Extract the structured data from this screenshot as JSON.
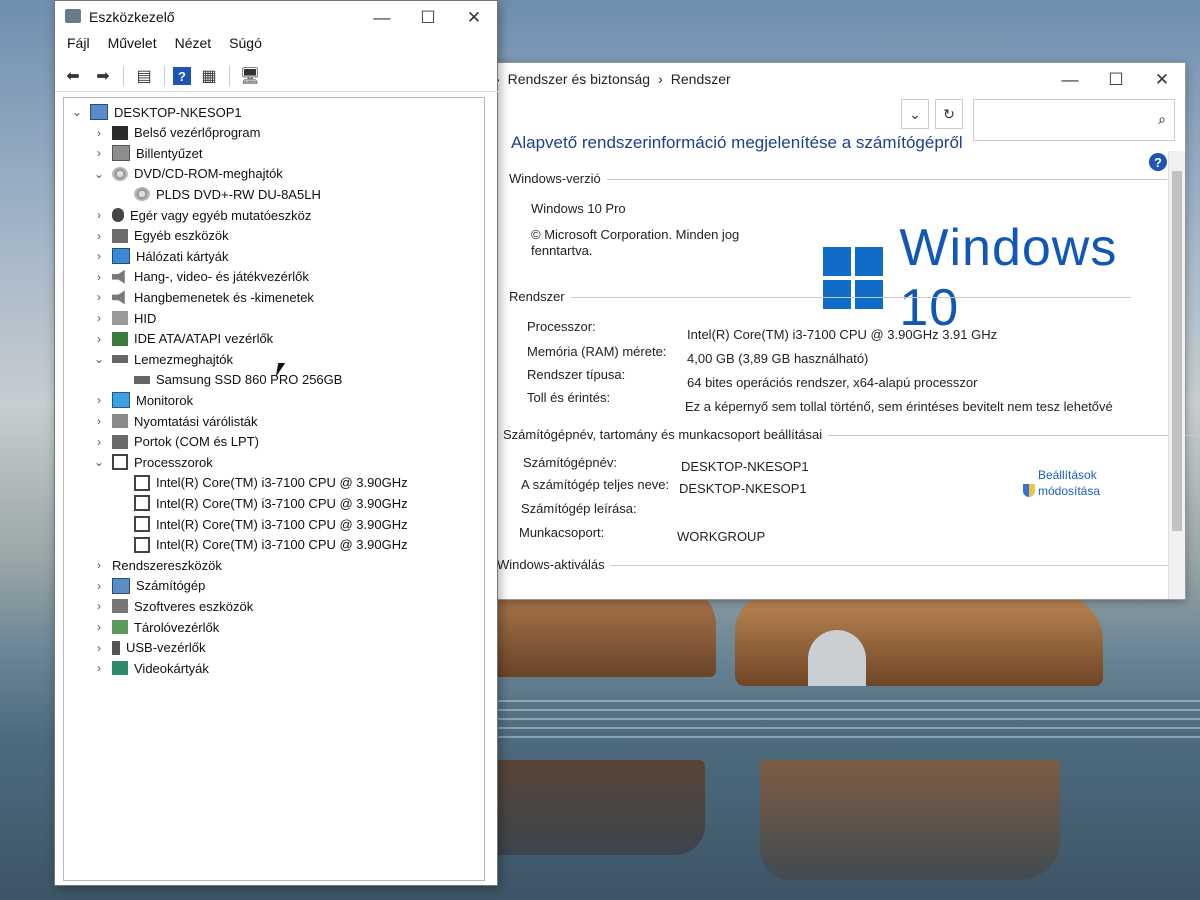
{
  "device_manager": {
    "title": "Eszközkezelő",
    "menu": [
      "Fájl",
      "Művelet",
      "Nézet",
      "Súgó"
    ],
    "tree": [
      {
        "label": "DESKTOP-NKESOP1",
        "level": 0,
        "expanded": true,
        "icon": "computer-icon"
      },
      {
        "label": "Belső vezérlőprogram",
        "level": 1,
        "expanded": false,
        "icon": "chip-icon"
      },
      {
        "label": "Billentyűzet",
        "level": 1,
        "expanded": false,
        "icon": "keyboard-icon"
      },
      {
        "label": "DVD/CD-ROM-meghajtók",
        "level": 1,
        "expanded": true,
        "icon": "disc-icon"
      },
      {
        "label": "PLDS DVD+-RW DU-8A5LH",
        "level": 2,
        "icon": "disc-icon"
      },
      {
        "label": "Egér vagy egyéb mutatóeszköz",
        "level": 1,
        "expanded": false,
        "icon": "mouse-icon"
      },
      {
        "label": "Egyéb eszközök",
        "level": 1,
        "expanded": false,
        "icon": "other-device-icon"
      },
      {
        "label": "Hálózati kártyák",
        "level": 1,
        "expanded": false,
        "icon": "network-icon"
      },
      {
        "label": "Hang-, video- és játékvezérlők",
        "level": 1,
        "expanded": false,
        "icon": "sound-icon"
      },
      {
        "label": "Hangbemenetek és -kimenetek",
        "level": 1,
        "expanded": false,
        "icon": "speaker-icon"
      },
      {
        "label": "HID",
        "level": 1,
        "expanded": false,
        "icon": "hid-icon"
      },
      {
        "label": "IDE ATA/ATAPI vezérlők",
        "level": 1,
        "expanded": false,
        "icon": "ide-icon"
      },
      {
        "label": "Lemezmeghajtók",
        "level": 1,
        "expanded": true,
        "icon": "disk-icon"
      },
      {
        "label": "Samsung SSD 860 PRO 256GB",
        "level": 2,
        "icon": "disk-icon"
      },
      {
        "label": "Monitorok",
        "level": 1,
        "expanded": false,
        "icon": "monitor-icon"
      },
      {
        "label": "Nyomtatási várólisták",
        "level": 1,
        "expanded": false,
        "icon": "printer-icon"
      },
      {
        "label": "Portok (COM és LPT)",
        "level": 1,
        "expanded": false,
        "icon": "port-icon"
      },
      {
        "label": "Processzorok",
        "level": 1,
        "expanded": true,
        "icon": "cpu-icon"
      },
      {
        "label": "Intel(R) Core(TM) i3-7100 CPU @ 3.90GHz",
        "level": 2,
        "icon": "cpu-icon"
      },
      {
        "label": "Intel(R) Core(TM) i3-7100 CPU @ 3.90GHz",
        "level": 2,
        "icon": "cpu-icon"
      },
      {
        "label": "Intel(R) Core(TM) i3-7100 CPU @ 3.90GHz",
        "level": 2,
        "icon": "cpu-icon"
      },
      {
        "label": "Intel(R) Core(TM) i3-7100 CPU @ 3.90GHz",
        "level": 2,
        "icon": "cpu-icon"
      },
      {
        "label": "Rendszereszközök",
        "level": 1,
        "expanded": false,
        "icon": "system-device-icon"
      },
      {
        "label": "Számítógép",
        "level": 1,
        "expanded": false,
        "icon": "computer-icon"
      },
      {
        "label": "Szoftveres eszközök",
        "level": 1,
        "expanded": false,
        "icon": "software-device-icon"
      },
      {
        "label": "Tárolóvezérlők",
        "level": 1,
        "expanded": false,
        "icon": "storage-icon"
      },
      {
        "label": "USB-vezérlők",
        "level": 1,
        "expanded": false,
        "icon": "usb-icon"
      },
      {
        "label": "Videokártyák",
        "level": 1,
        "expanded": false,
        "icon": "gpu-icon"
      }
    ]
  },
  "system": {
    "breadcrumb": [
      "Rendszer és biztonság",
      "Rendszer"
    ],
    "heading": "Alapvető rendszerinformáció megjelenítése a számítógépről",
    "windows_edition_section": "Windows-verzió",
    "edition": "Windows 10 Pro",
    "copyright": "© Microsoft Corporation. Minden jog fenntartva.",
    "logo_text": "Windows 10",
    "system_section": "Rendszer",
    "system_rows": [
      {
        "label": "Processzor:",
        "value": "Intel(R) Core(TM) i3-7100 CPU @ 3.90GHz   3.91 GHz"
      },
      {
        "label": "Memória (RAM) mérete:",
        "value": "4,00 GB (3,89 GB használható)"
      },
      {
        "label": "Rendszer típusa:",
        "value": "64 bites operációs rendszer, x64-alapú processzor"
      },
      {
        "label": "Toll és érintés:",
        "value": "Ez a képernyő sem tollal történő, sem érintéses bevitelt nem tesz lehetővé"
      }
    ],
    "computer_section": "Számítógépnév, tartomány és munkacsoport beállításai",
    "computer_rows": [
      {
        "label": "Számítógépnév:",
        "value": "DESKTOP-NKESOP1"
      },
      {
        "label": "A számítógép teljes neve:",
        "value": "DESKTOP-NKESOP1"
      },
      {
        "label": "Számítógép leírása:",
        "value": ""
      },
      {
        "label": "Munkacsoport:",
        "value": "WORKGROUP"
      }
    ],
    "change_settings": "Beállítások módosítása",
    "activation_section": "Windows-aktiválás"
  }
}
